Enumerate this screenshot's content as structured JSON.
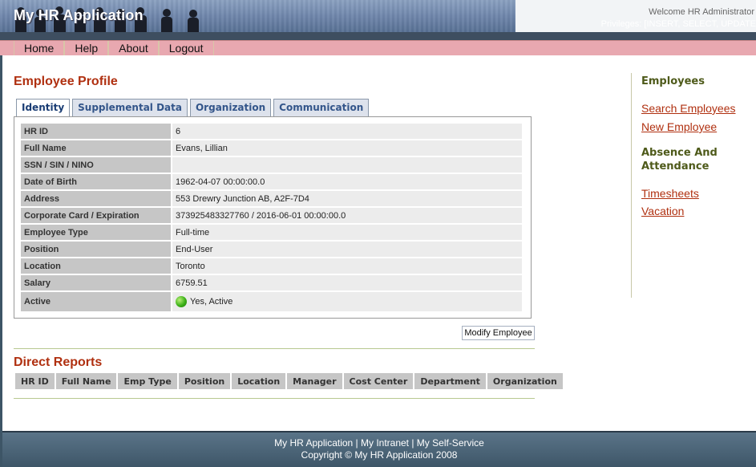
{
  "header": {
    "app_title": "My HR Application",
    "welcome": "Welcome HR Administrator",
    "privileges": "Privileges: [INSERT, SELECT, UPDATE"
  },
  "nav": {
    "items": [
      {
        "label": "Home"
      },
      {
        "label": "Help"
      },
      {
        "label": "About"
      },
      {
        "label": "Logout"
      }
    ]
  },
  "profile": {
    "title": "Employee Profile",
    "tabs": [
      {
        "label": "Identity",
        "active": true
      },
      {
        "label": "Supplemental Data",
        "active": false
      },
      {
        "label": "Organization",
        "active": false
      },
      {
        "label": "Communication",
        "active": false
      }
    ],
    "fields": [
      {
        "label": "HR ID",
        "value": "6"
      },
      {
        "label": "Full Name",
        "value": "Evans, Lillian"
      },
      {
        "label": "SSN / SIN / NINO",
        "value": ""
      },
      {
        "label": "Date of Birth",
        "value": "1962-04-07 00:00:00.0"
      },
      {
        "label": "Address",
        "value": "553 Drewry Junction AB, A2F-7D4"
      },
      {
        "label": "Corporate Card / Expiration",
        "value": "373925483327760 / 2016-06-01 00:00:00.0"
      },
      {
        "label": "Employee Type",
        "value": "Full-time"
      },
      {
        "label": "Position",
        "value": "End-User"
      },
      {
        "label": "Location",
        "value": "Toronto"
      },
      {
        "label": "Salary",
        "value": "6759.51"
      },
      {
        "label": "Active",
        "value": "Yes, Active"
      }
    ],
    "modify_button": "Modify Employee"
  },
  "direct_reports": {
    "title": "Direct Reports",
    "columns": [
      "HR ID",
      "Full Name",
      "Emp Type",
      "Position",
      "Location",
      "Manager",
      "Cost Center",
      "Department",
      "Organization"
    ]
  },
  "sidebar": {
    "employees_heading": "Employees",
    "employee_links": [
      "Search Employees",
      "New Employee"
    ],
    "absence_heading": "Absence And Attendance",
    "absence_links": [
      "Timesheets",
      "Vacation"
    ]
  },
  "footer": {
    "links_line": "My HR Application | My Intranet | My Self-Service",
    "copyright": "Copyright © My HR Application 2008"
  },
  "colors": {
    "accent_title": "#b03010",
    "nav_bg": "#e8a8b0",
    "sidebar_heading": "#4e5a1a",
    "active_status": "#3cb018"
  }
}
